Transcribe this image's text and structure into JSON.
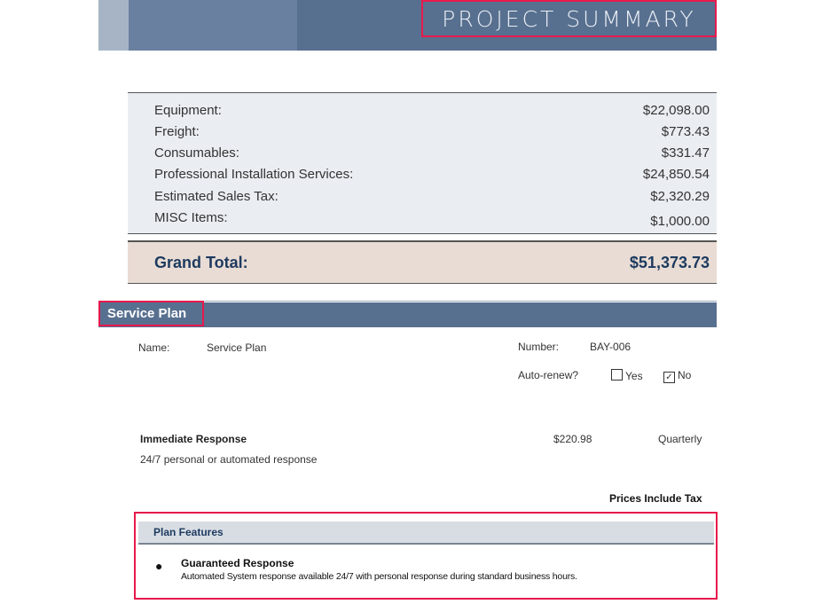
{
  "header": {
    "title": "PROJECT SUMMARY"
  },
  "costs": [
    {
      "label": "Equipment:",
      "value": "$22,098.00"
    },
    {
      "label": "Freight:",
      "value": "$773.43"
    },
    {
      "label": "Consumables:",
      "value": "$331.47"
    },
    {
      "label": "Professional Installation Services:",
      "value": "$24,850.54"
    },
    {
      "label": "Estimated Sales Tax:",
      "value": "$2,320.29"
    },
    {
      "label": "MISC Items:",
      "value": "$1,000.00"
    }
  ],
  "grand_total": {
    "label": "Grand Total:",
    "value": "$51,373.73"
  },
  "service_plan": {
    "section_title": "Service Plan",
    "name_label": "Name:",
    "name_value": "Service Plan",
    "number_label": "Number:",
    "number_value": "BAY-006",
    "auto_renew_label": "Auto-renew?",
    "yes_label": "Yes",
    "no_label": "No",
    "yes_checked": false,
    "no_checked": true,
    "item": {
      "name": "Immediate Response",
      "description": "24/7 personal or automated response",
      "price": "$220.98",
      "frequency": "Quarterly"
    },
    "tax_note": "Prices Include Tax"
  },
  "features": {
    "heading": "Plan Features",
    "items": [
      {
        "name": "Guaranteed Response",
        "description": "Automated System response available 24/7 with personal response during standard business hours."
      }
    ]
  },
  "colors": {
    "banner": "#58708f",
    "highlight": "#e8194c",
    "heading_text": "#1d3a5f"
  }
}
